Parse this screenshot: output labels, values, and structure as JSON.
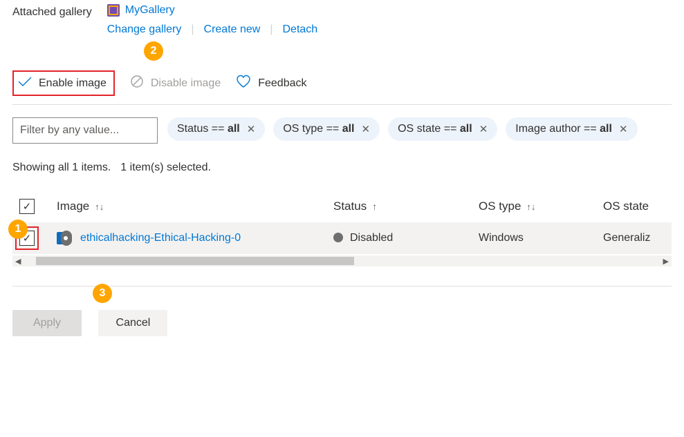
{
  "gallery": {
    "label": "Attached gallery",
    "name": "MyGallery",
    "actions": {
      "change": "Change gallery",
      "create": "Create new",
      "detach": "Detach"
    }
  },
  "toolbar": {
    "enable": "Enable image",
    "disable": "Disable image",
    "feedback": "Feedback"
  },
  "filters": {
    "placeholder": "Filter by any value...",
    "pills": [
      {
        "label": "Status == ",
        "value": "all"
      },
      {
        "label": "OS type == ",
        "value": "all"
      },
      {
        "label": "OS state == ",
        "value": "all"
      },
      {
        "label": "Image author == ",
        "value": "all"
      }
    ]
  },
  "results": {
    "showing": "Showing all 1 items.",
    "selected": "1 item(s) selected."
  },
  "columns": {
    "image": "Image",
    "status": "Status",
    "ostype": "OS type",
    "osstate": "OS state"
  },
  "rows": [
    {
      "name": "ethicalhacking-Ethical-Hacking-0",
      "status": "Disabled",
      "ostype": "Windows",
      "osstate": "Generaliz"
    }
  ],
  "footer": {
    "apply": "Apply",
    "cancel": "Cancel"
  },
  "badges": {
    "one": "1",
    "two": "2",
    "three": "3"
  }
}
